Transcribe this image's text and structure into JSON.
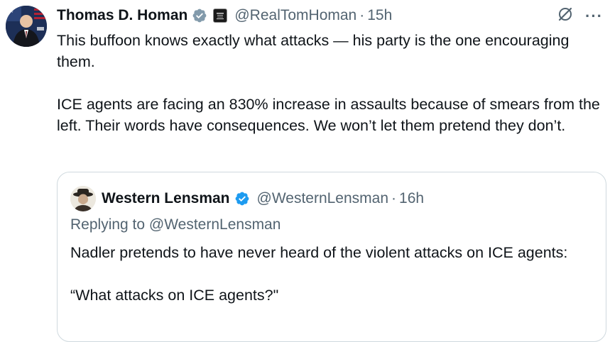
{
  "tweet": {
    "author_name": "Thomas D. Homan",
    "handle": "@RealTomHoman",
    "separator": "·",
    "time": "15h",
    "paragraphs": [
      "This buffoon knows exactly what attacks — his party is the one encouraging them.",
      "ICE agents are facing an 830% increase in assaults because of smears from the left. Their words have consequences. We won’t let them pretend they don’t."
    ],
    "more_label": "···"
  },
  "quote": {
    "author_name": "Western Lensman",
    "handle": "@WesternLensman",
    "separator": "·",
    "time": "16h",
    "replying_prefix": "Replying to",
    "replying_to": "@WesternLensman",
    "paragraphs": [
      "Nadler pretends to have never heard of the violent attacks on ICE agents:",
      "“What attacks on ICE agents?\""
    ]
  },
  "colors": {
    "verified": "#1d9bf0",
    "secondary_text": "#536471",
    "border": "#cfd9de"
  }
}
